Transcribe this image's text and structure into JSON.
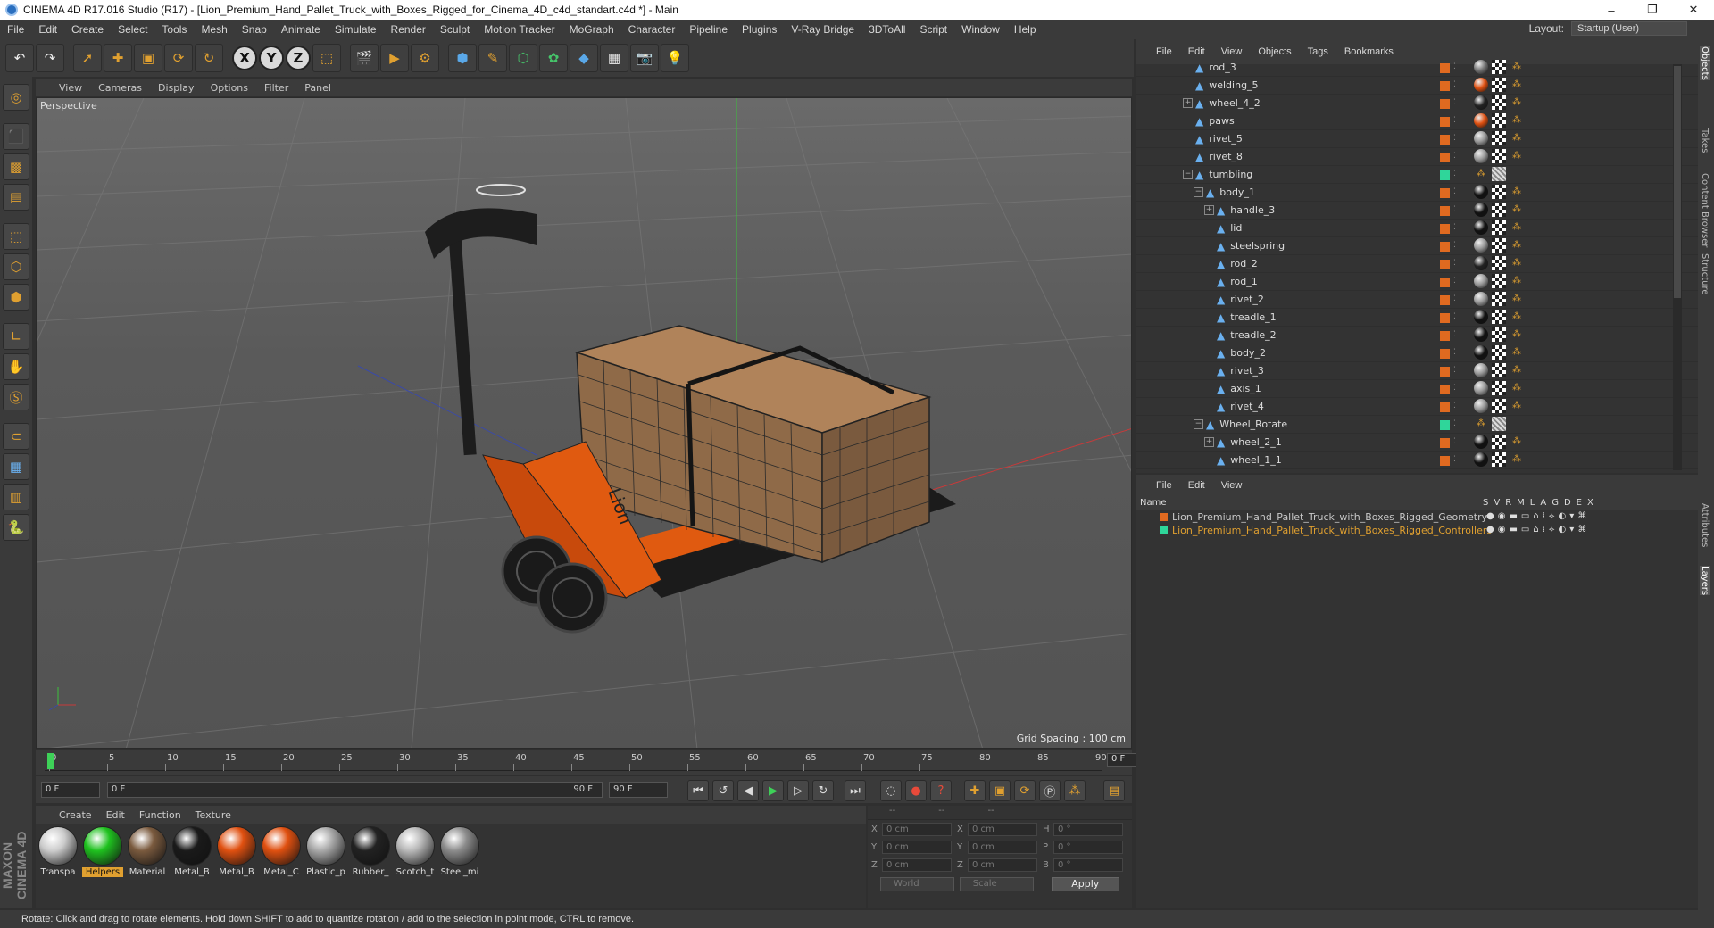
{
  "window": {
    "title": "CINEMA 4D R17.016 Studio (R17) - [Lion_Premium_Hand_Pallet_Truck_with_Boxes_Rigged_for_Cinema_4D_c4d_standart.c4d *] - Main",
    "minimize": "–",
    "maximize": "❐",
    "close": "✕"
  },
  "menu": {
    "items": [
      "File",
      "Edit",
      "Create",
      "Select",
      "Tools",
      "Mesh",
      "Snap",
      "Animate",
      "Simulate",
      "Render",
      "Sculpt",
      "Motion Tracker",
      "MoGraph",
      "Character",
      "Pipeline",
      "Plugins",
      "V-Ray Bridge",
      "3DToAll",
      "Script",
      "Window",
      "Help"
    ],
    "layout_label": "Layout:",
    "layout_value": "Startup (User)"
  },
  "viewport": {
    "menu": [
      "View",
      "Cameras",
      "Display",
      "Options",
      "Filter",
      "Panel"
    ],
    "label": "Perspective",
    "grid_spacing": "Grid Spacing : 100 cm",
    "box_label": "Lion"
  },
  "timeline": {
    "ticks": [
      "0",
      "5",
      "10",
      "15",
      "20",
      "25",
      "30",
      "35",
      "40",
      "45",
      "50",
      "55",
      "60",
      "65",
      "70",
      "75",
      "80",
      "85",
      "90"
    ],
    "current_frame": "0 F"
  },
  "playback": {
    "start": "0 F",
    "range_start": "0 F",
    "range_end": "90 F",
    "end": "90 F"
  },
  "materials": {
    "menu": [
      "Create",
      "Edit",
      "Function",
      "Texture"
    ],
    "items": [
      {
        "name": "Transpa",
        "color": "#cccccc",
        "selected": false
      },
      {
        "name": "Helpers",
        "color": "#1fc21f",
        "selected": true
      },
      {
        "name": "Material",
        "color": "#7a5a3e",
        "selected": false
      },
      {
        "name": "Metal_B",
        "color": "#1a1a1a",
        "selected": false
      },
      {
        "name": "Metal_B",
        "color": "#e05010",
        "selected": false
      },
      {
        "name": "Metal_C",
        "color": "#e05010",
        "selected": false
      },
      {
        "name": "Plastic_p",
        "color": "#a8a8a8",
        "selected": false
      },
      {
        "name": "Rubber_",
        "color": "#222222",
        "selected": false
      },
      {
        "name": "Scotch_t",
        "color": "#b8b8b8",
        "selected": false
      },
      {
        "name": "Steel_mi",
        "color": "#8c8c8c",
        "selected": false
      }
    ]
  },
  "attributes": {
    "header": [
      "--",
      "--",
      "--"
    ],
    "rows": [
      {
        "a": "X",
        "av": "0 cm",
        "b": "X",
        "bv": "0 cm",
        "c": "H",
        "cv": "0 °"
      },
      {
        "a": "Y",
        "av": "0 cm",
        "b": "Y",
        "bv": "0 cm",
        "c": "P",
        "cv": "0 °"
      },
      {
        "a": "Z",
        "av": "0 cm",
        "b": "Z",
        "bv": "0 cm",
        "c": "B",
        "cv": "0 °"
      }
    ],
    "coord_mode": "World",
    "size_mode": "Scale",
    "apply": "Apply"
  },
  "status": "Rotate: Click and drag to rotate elements. Hold down SHIFT to add to quantize rotation / add to the selection in point mode, CTRL to remove.",
  "object_manager": {
    "menu": [
      "File",
      "Edit",
      "View",
      "Objects",
      "Tags",
      "Bookmarks"
    ],
    "rows": [
      {
        "name": "rod_3",
        "indent": 1,
        "expand": "",
        "layer": "orange",
        "tags": [
          "#777",
          "check",
          "dots"
        ]
      },
      {
        "name": "welding_5",
        "indent": 1,
        "expand": "",
        "layer": "orange",
        "tags": [
          "#e05010",
          "check",
          "dots"
        ]
      },
      {
        "name": "wheel_4_2",
        "indent": 1,
        "expand": "+",
        "layer": "orange",
        "tags": [
          "#222",
          "check",
          "dots"
        ]
      },
      {
        "name": "paws",
        "indent": 1,
        "expand": "",
        "layer": "orange",
        "tags": [
          "#e05010",
          "check",
          "dots"
        ]
      },
      {
        "name": "rivet_5",
        "indent": 1,
        "expand": "",
        "layer": "orange",
        "tags": [
          "#999",
          "check",
          "dots"
        ]
      },
      {
        "name": "rivet_8",
        "indent": 1,
        "expand": "",
        "layer": "orange",
        "tags": [
          "#999",
          "check",
          "dots"
        ]
      },
      {
        "name": "tumbling",
        "indent": 1,
        "expand": "−",
        "layer": "green",
        "tags": [
          "dots",
          "hatch"
        ]
      },
      {
        "name": "body_1",
        "indent": 2,
        "expand": "−",
        "layer": "orange",
        "tags": [
          "#111",
          "check",
          "dots"
        ]
      },
      {
        "name": "handle_3",
        "indent": 3,
        "expand": "+",
        "layer": "orange",
        "tags": [
          "#111",
          "check",
          "dots"
        ]
      },
      {
        "name": "lid",
        "indent": 3,
        "expand": "",
        "layer": "orange",
        "tags": [
          "#111",
          "check",
          "dots"
        ]
      },
      {
        "name": "steelspring",
        "indent": 3,
        "expand": "",
        "layer": "orange",
        "tags": [
          "#999",
          "check",
          "dots"
        ]
      },
      {
        "name": "rod_2",
        "indent": 3,
        "expand": "",
        "layer": "orange",
        "tags": [
          "#222",
          "check",
          "dots"
        ]
      },
      {
        "name": "rod_1",
        "indent": 3,
        "expand": "",
        "layer": "orange",
        "tags": [
          "#999",
          "check",
          "dots"
        ]
      },
      {
        "name": "rivet_2",
        "indent": 3,
        "expand": "",
        "layer": "orange",
        "tags": [
          "#999",
          "check",
          "dots"
        ]
      },
      {
        "name": "treadle_1",
        "indent": 3,
        "expand": "",
        "layer": "orange",
        "tags": [
          "#111",
          "check",
          "dots"
        ]
      },
      {
        "name": "treadle_2",
        "indent": 3,
        "expand": "",
        "layer": "orange",
        "tags": [
          "#111",
          "check",
          "dots"
        ]
      },
      {
        "name": "body_2",
        "indent": 3,
        "expand": "",
        "layer": "orange",
        "tags": [
          "#111",
          "check",
          "dots"
        ]
      },
      {
        "name": "rivet_3",
        "indent": 3,
        "expand": "",
        "layer": "orange",
        "tags": [
          "#999",
          "check",
          "dots"
        ]
      },
      {
        "name": "axis_1",
        "indent": 3,
        "expand": "",
        "layer": "orange",
        "tags": [
          "#999",
          "check",
          "dots"
        ]
      },
      {
        "name": "rivet_4",
        "indent": 3,
        "expand": "",
        "layer": "orange",
        "tags": [
          "#999",
          "check",
          "dots"
        ]
      },
      {
        "name": "Wheel_Rotate",
        "indent": 2,
        "expand": "−",
        "layer": "green",
        "tags": [
          "dots",
          "hatch"
        ]
      },
      {
        "name": "wheel_2_1",
        "indent": 3,
        "expand": "+",
        "layer": "orange",
        "tags": [
          "#111",
          "check",
          "dots"
        ]
      },
      {
        "name": "wheel_1_1",
        "indent": 3,
        "expand": "",
        "layer": "orange",
        "tags": [
          "#111",
          "check",
          "dots"
        ]
      }
    ]
  },
  "layer_manager": {
    "menu": [
      "File",
      "Edit",
      "View"
    ],
    "name_col": "Name",
    "flag_cols": [
      "S",
      "V",
      "R",
      "M",
      "L",
      "A",
      "G",
      "D",
      "E",
      "X"
    ],
    "layers": [
      {
        "name": "Lion_Premium_Hand_Pallet_Truck_with_Boxes_Rigged_Geometry",
        "color": "#e06a20"
      },
      {
        "name": "Lion_Premium_Hand_Pallet_Truck_with_Boxes_Rigged_Controllers",
        "color": "#2fd69a"
      }
    ]
  },
  "side_tabs": [
    "Objects",
    "Takes",
    "Content Browser",
    "Structure",
    "Attributes",
    "Layers"
  ]
}
